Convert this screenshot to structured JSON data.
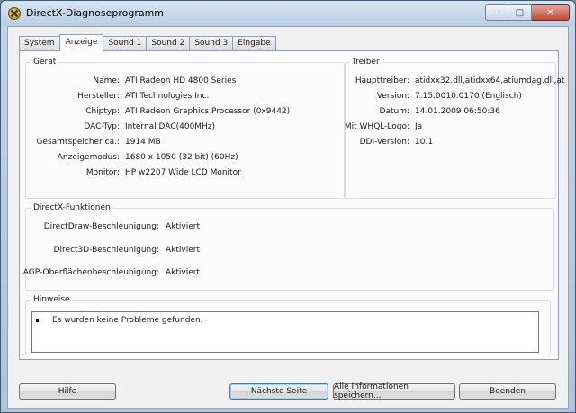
{
  "window": {
    "title": "DirectX-Diagnoseprogramm"
  },
  "caption": {
    "minimize": "–",
    "maximize": "□",
    "close": "✕"
  },
  "icons": {
    "app": "directx-icon"
  },
  "tabs": [
    {
      "label": "System"
    },
    {
      "label": "Anzeige",
      "active": true
    },
    {
      "label": "Sound 1"
    },
    {
      "label": "Sound 2"
    },
    {
      "label": "Sound 3"
    },
    {
      "label": "Eingabe"
    }
  ],
  "device": {
    "title": "Gerät",
    "rows": [
      {
        "label": "Name:",
        "value": "ATI Radeon HD 4800 Series"
      },
      {
        "label": "Hersteller:",
        "value": "ATI Technologies Inc."
      },
      {
        "label": "Chiptyp:",
        "value": "ATI Radeon Graphics Processor (0x9442)"
      },
      {
        "label": "DAC-Typ:",
        "value": "Internal DAC(400MHz)"
      },
      {
        "label": "Gesamtspeicher ca.:",
        "value": "1914 MB"
      },
      {
        "label": "Anzeigemodus:",
        "value": "1680 x 1050 (32 bit) (60Hz)"
      },
      {
        "label": "Monitor:",
        "value": "HP w2207 Wide LCD Monitor"
      }
    ]
  },
  "driver": {
    "title": "Treiber",
    "rows": [
      {
        "label": "Haupttreiber:",
        "value": "atidxx32.dll,atidxx64,atiumdag.dll,at"
      },
      {
        "label": "Version:",
        "value": "7.15.0010.0170 (Englisch)"
      },
      {
        "label": "Datum:",
        "value": "14.01.2009 06:50:36"
      },
      {
        "label": "Mit WHQL-Logo:",
        "value": "Ja"
      },
      {
        "label": "DDI-Version:",
        "value": "10.1"
      }
    ]
  },
  "directx": {
    "title": "DirectX-Funktionen",
    "rows": [
      {
        "label": "DirectDraw-Beschleunigung:",
        "value": "Aktiviert"
      },
      {
        "label": "Direct3D-Beschleunigung:",
        "value": "Aktiviert"
      },
      {
        "label": "AGP-Oberflächenbeschleunigung:",
        "value": "Aktiviert"
      }
    ]
  },
  "notes": {
    "title": "Hinweise",
    "items": [
      "Es wurden keine Probleme gefunden."
    ]
  },
  "buttons": {
    "help": "Hilfe",
    "next": "Nächste Seite",
    "save_all": "Alle Informationen speichern...",
    "exit": "Beenden"
  }
}
